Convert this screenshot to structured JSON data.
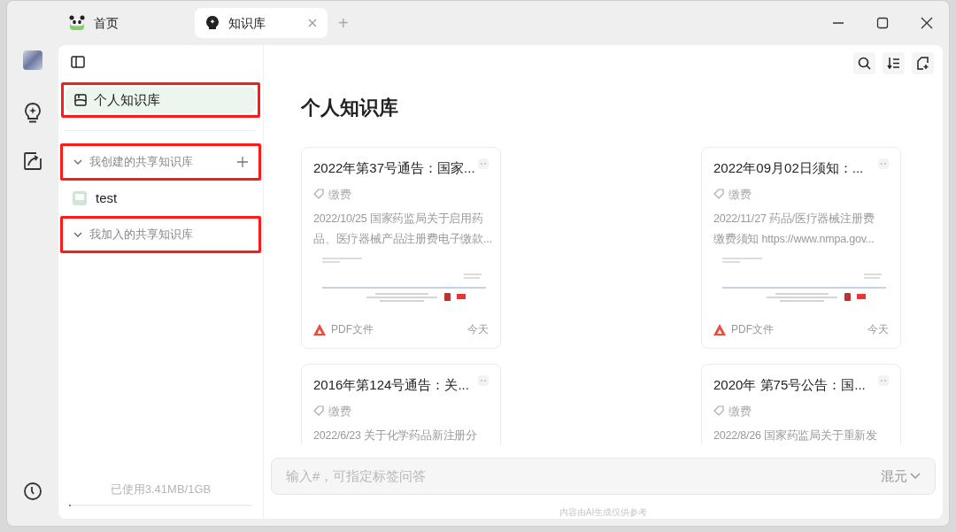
{
  "tabs": [
    {
      "label": "首页",
      "selected": false,
      "closable": false
    },
    {
      "label": "知识库",
      "selected": true,
      "closable": true
    }
  ],
  "tab_add": "+",
  "sidebar": {
    "personal": {
      "label": "个人知识库",
      "selected": true,
      "highlighted": true
    },
    "sections": [
      {
        "label": "我创建的共享知识库",
        "expanded": true,
        "highlighted": true,
        "addable": true,
        "children": [
          {
            "label": "test",
            "selected": false
          }
        ]
      },
      {
        "label": "我加入的共享知识库",
        "expanded": true,
        "highlighted": true,
        "addable": false
      }
    ],
    "storage": {
      "text": "已使用3.41MB/1GB",
      "level": 0.004
    }
  },
  "main": {
    "title": "个人知识库",
    "cards": [
      {
        "title": "2022年第37号通告：国家...",
        "tag": "缴费",
        "summary": [
          "2022/10/25 国家药监局关于启用药",
          "品、医疗器械产品注册费电子缴款..."
        ],
        "file_type": "PDF文件",
        "date": "今天",
        "preview": true
      },
      {
        "title": "2022年09月02日须知：...",
        "tag": "缴费",
        "summary": [
          "2022/11/27 药品/医疗器械注册费",
          "缴费须知 https://www.nmpa.gov..."
        ],
        "file_type": "PDF文件",
        "date": "今天",
        "preview": true
      },
      {
        "title": "2016年第124号通告：关...",
        "tag": "缴费",
        "summary": [
          "2022/6/23 关于化学药品新注册分"
        ],
        "preview": false
      },
      {
        "title": "2020年 第75号公告：国...",
        "tag": "缴费",
        "summary": [
          "2022/8/26 国家药监局关于重新发"
        ],
        "preview": false
      }
    ],
    "input": {
      "placeholder": "输入#，可指定标签问答",
      "model": "混元"
    },
    "footnote": "内容由AI生成仅供参考"
  }
}
